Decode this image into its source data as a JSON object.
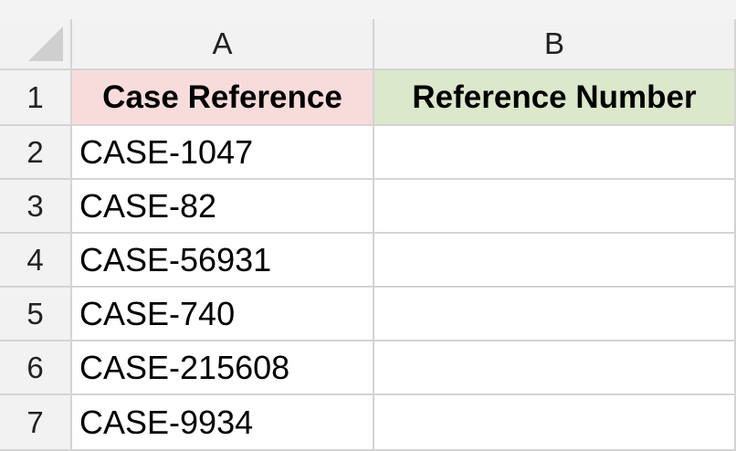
{
  "spreadsheet": {
    "columns": [
      "A",
      "B"
    ],
    "rows": [
      "1",
      "2",
      "3",
      "4",
      "5",
      "6",
      "7"
    ],
    "headers": {
      "a": {
        "text": "Case Reference",
        "fill": "#f8dcdc"
      },
      "b": {
        "text": "Reference Number",
        "fill": "#dbe8cb"
      }
    },
    "data": [
      {
        "a": "CASE-1047",
        "b": ""
      },
      {
        "a": "CASE-82",
        "b": ""
      },
      {
        "a": "CASE-56931",
        "b": ""
      },
      {
        "a": "CASE-740",
        "b": ""
      },
      {
        "a": "CASE-215608",
        "b": ""
      },
      {
        "a": "CASE-9934",
        "b": ""
      }
    ]
  }
}
